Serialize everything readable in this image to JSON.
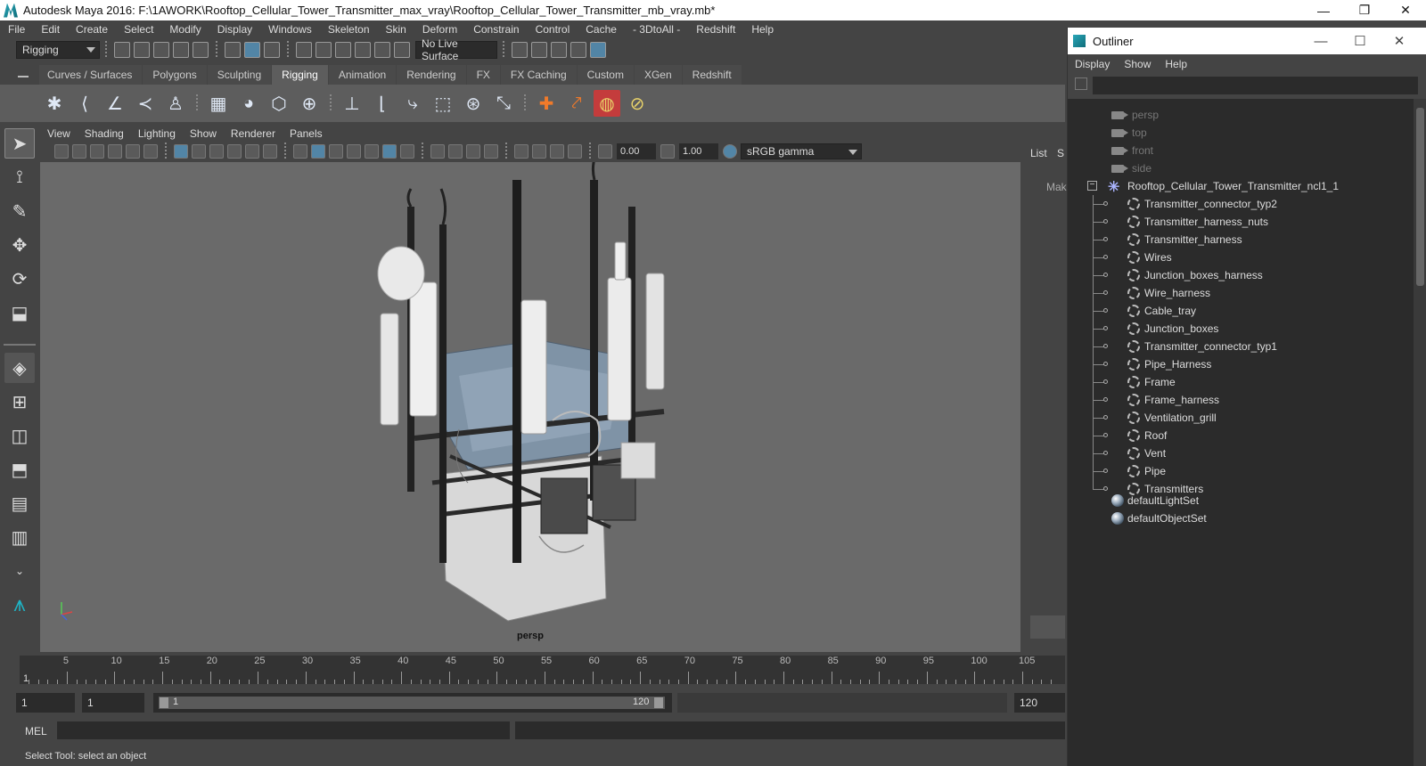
{
  "app": {
    "title": "Autodesk Maya 2016: F:\\1AWORK\\Rooftop_Cellular_Tower_Transmitter_max_vray\\Rooftop_Cellular_Tower_Transmitter_mb_vray.mb*",
    "window_buttons": [
      "—",
      "❐",
      "✕"
    ]
  },
  "menubar": [
    "File",
    "Edit",
    "Create",
    "Select",
    "Modify",
    "Display",
    "Windows",
    "Skeleton",
    "Skin",
    "Deform",
    "Constrain",
    "Control",
    "Cache",
    "- 3DtoAll -",
    "Redshift",
    "Help"
  ],
  "statusline": {
    "mode": "Rigging",
    "live_surface": "No Live Surface"
  },
  "shelf": {
    "tabs": [
      "Curves / Surfaces",
      "Polygons",
      "Sculpting",
      "Rigging",
      "Animation",
      "Rendering",
      "FX",
      "FX Caching",
      "Custom",
      "XGen",
      "Redshift"
    ],
    "active_tab": "Rigging"
  },
  "viewport": {
    "menus": [
      "View",
      "Shading",
      "Lighting",
      "Show",
      "Renderer",
      "Panels"
    ],
    "exposure": "0.00",
    "gamma": "1.00",
    "colorspace": "sRGB gamma",
    "camera": "persp"
  },
  "side_panel": {
    "list_label": "List",
    "s_label": "S",
    "mak_label": "Mak"
  },
  "timeline": {
    "ticks": [
      "5",
      "10",
      "15",
      "20",
      "25",
      "30",
      "35",
      "40",
      "45",
      "50",
      "55",
      "60",
      "65",
      "70",
      "75",
      "80",
      "85",
      "90",
      "95",
      "100",
      "105"
    ],
    "current_frame": "1"
  },
  "range": {
    "start": "1",
    "anim_start": "1",
    "slider_start": "1",
    "slider_end": "120",
    "end": "120"
  },
  "command": {
    "language": "MEL"
  },
  "helpline": "Select Tool: select an object",
  "outliner": {
    "title": "Outliner",
    "menus": [
      "Display",
      "Show",
      "Help"
    ],
    "cameras": [
      "persp",
      "top",
      "front",
      "side"
    ],
    "group": "Rooftop_Cellular_Tower_Transmitter_ncl1_1",
    "children": [
      "Transmitter_connector_typ2",
      "Transmitter_harness_nuts",
      "Transmitter_harness",
      "Wires",
      "Junction_boxes_harness",
      "Wire_harness",
      "Cable_tray",
      "Junction_boxes",
      "Transmitter_connector_typ1",
      "Pipe_Harness",
      "Frame",
      "Frame_harness",
      "Ventilation_grill",
      "Roof",
      "Vent",
      "Pipe",
      "Transmitters"
    ],
    "sets": [
      "defaultLightSet",
      "defaultObjectSet"
    ]
  }
}
